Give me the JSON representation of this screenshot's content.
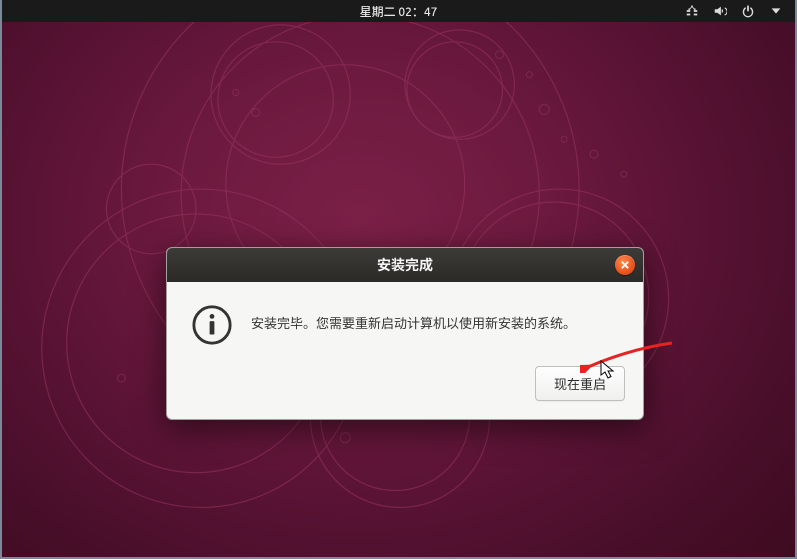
{
  "topbar": {
    "datetime": "星期二 02：47"
  },
  "dialog": {
    "title": "安装完成",
    "message": "安装完毕。您需要重新启动计算机以使用新安装的系统。",
    "restart_label": "现在重启"
  },
  "icons": {
    "info": "info-icon",
    "close": "close-icon",
    "network": "network-icon",
    "volume": "volume-icon",
    "power": "power-icon",
    "dropdown": "chevron-down-icon"
  }
}
